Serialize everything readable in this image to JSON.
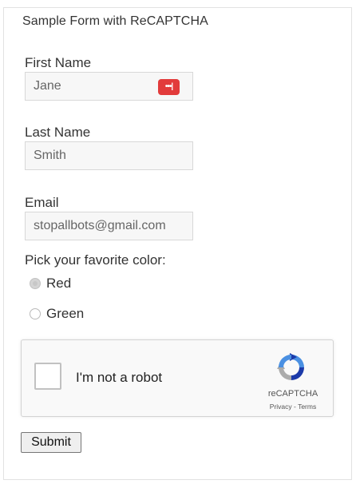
{
  "form": {
    "legend": "Sample Form with ReCAPTCHA",
    "first_name": {
      "label": "First Name",
      "value": "Jane",
      "badge_icon": "password-manager-icon",
      "badge_color": "#e23b3b"
    },
    "last_name": {
      "label": "Last Name",
      "value": "Smith"
    },
    "email": {
      "label": "Email",
      "value": "stopallbots@gmail.com"
    },
    "color_question": "Pick your favorite color:",
    "color_options": [
      {
        "label": "Red",
        "selected": true
      },
      {
        "label": "Green",
        "selected": false
      }
    ],
    "recaptcha": {
      "checkbox_label": "I'm not a robot",
      "brand": "reCAPTCHA",
      "privacy": "Privacy",
      "separator": " - ",
      "terms": "Terms",
      "checked": false
    },
    "submit_label": "Submit"
  }
}
